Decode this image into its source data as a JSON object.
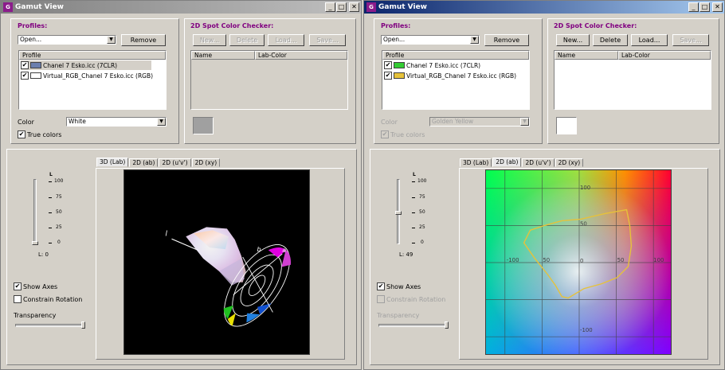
{
  "left": {
    "title": "Gamut View",
    "profiles_label": "Profiles:",
    "profile_select": "Open...",
    "remove_label": "Remove",
    "profile_header": "Profile",
    "profiles": [
      {
        "name": "Chanel 7 Esko.icc (7CLR)",
        "checked": "✔",
        "color": "#6b7fae"
      },
      {
        "name": "Virtual_RGB_Chanel 7 Esko.icc (RGB)",
        "checked": "✔",
        "color": "#ffffff"
      }
    ],
    "color_label": "Color",
    "color_value": "White",
    "true_colors_label": "True colors",
    "true_colors_check": "✔",
    "spot_title": "2D Spot Color Checker:",
    "spot_buttons": [
      "New...",
      "Delete",
      "Load...",
      "Save..."
    ],
    "spot_headers": [
      "Name",
      "Lab-Color"
    ],
    "spot_swatch": "#a0a0a0",
    "tabs": [
      "3D (Lab)",
      "2D (ab)",
      "2D (u'v')",
      "2D (xy)"
    ],
    "active_tab": "3D (Lab)",
    "slider_name": "L",
    "ticks": [
      "100",
      "75",
      "50",
      "25",
      "0"
    ],
    "l_value": "L: 0",
    "show_axes_label": "Show Axes",
    "show_axes_check": "✔",
    "constrain_label": "Constrain Rotation",
    "transparency_label": "Transparency",
    "axis_labels_3d": [
      "l",
      "b",
      "a"
    ]
  },
  "right": {
    "title": "Gamut View",
    "profiles_label": "Profiles:",
    "profile_select": "Open...",
    "remove_label": "Remove",
    "profile_header": "Profile",
    "profiles": [
      {
        "name": "Chanel 7 Esko.icc (7CLR)",
        "checked": "✔",
        "color": "#33cc33"
      },
      {
        "name": "Virtual_RGB_Chanel 7 Esko.icc (RGB)",
        "checked": "✔",
        "color": "#e6c23a"
      }
    ],
    "color_label": "Color",
    "color_value": "Golden Yellow",
    "true_colors_label": "True colors",
    "true_colors_check": "✔",
    "spot_title": "2D Spot Color Checker:",
    "spot_buttons": [
      "New...",
      "Delete",
      "Load...",
      "Save..."
    ],
    "spot_headers": [
      "Name",
      "Lab-Color"
    ],
    "spot_swatch": "#ffffff",
    "tabs": [
      "3D (Lab)",
      "2D (ab)",
      "2D (u'v')",
      "2D (xy)"
    ],
    "active_tab": "2D (ab)",
    "slider_name": "L",
    "ticks": [
      "100",
      "75",
      "50",
      "25",
      "0"
    ],
    "l_value": "L: 49",
    "show_axes_label": "Show Axes",
    "show_axes_check": "✔",
    "constrain_label": "Constrain Rotation",
    "transparency_label": "Transparency",
    "ab_plot": {
      "b_labels": [
        "100",
        "50",
        "0"
      ],
      "a_labels": [
        "-100",
        "50",
        "0",
        "50",
        "100"
      ],
      "bottom_label": "-100"
    }
  },
  "colors": {
    "face": "#d4d0c8",
    "active_title": "#0a246a",
    "inactive_title": "#808080",
    "label_purple": "#800080",
    "gamut_outline": "#e6c23a"
  }
}
